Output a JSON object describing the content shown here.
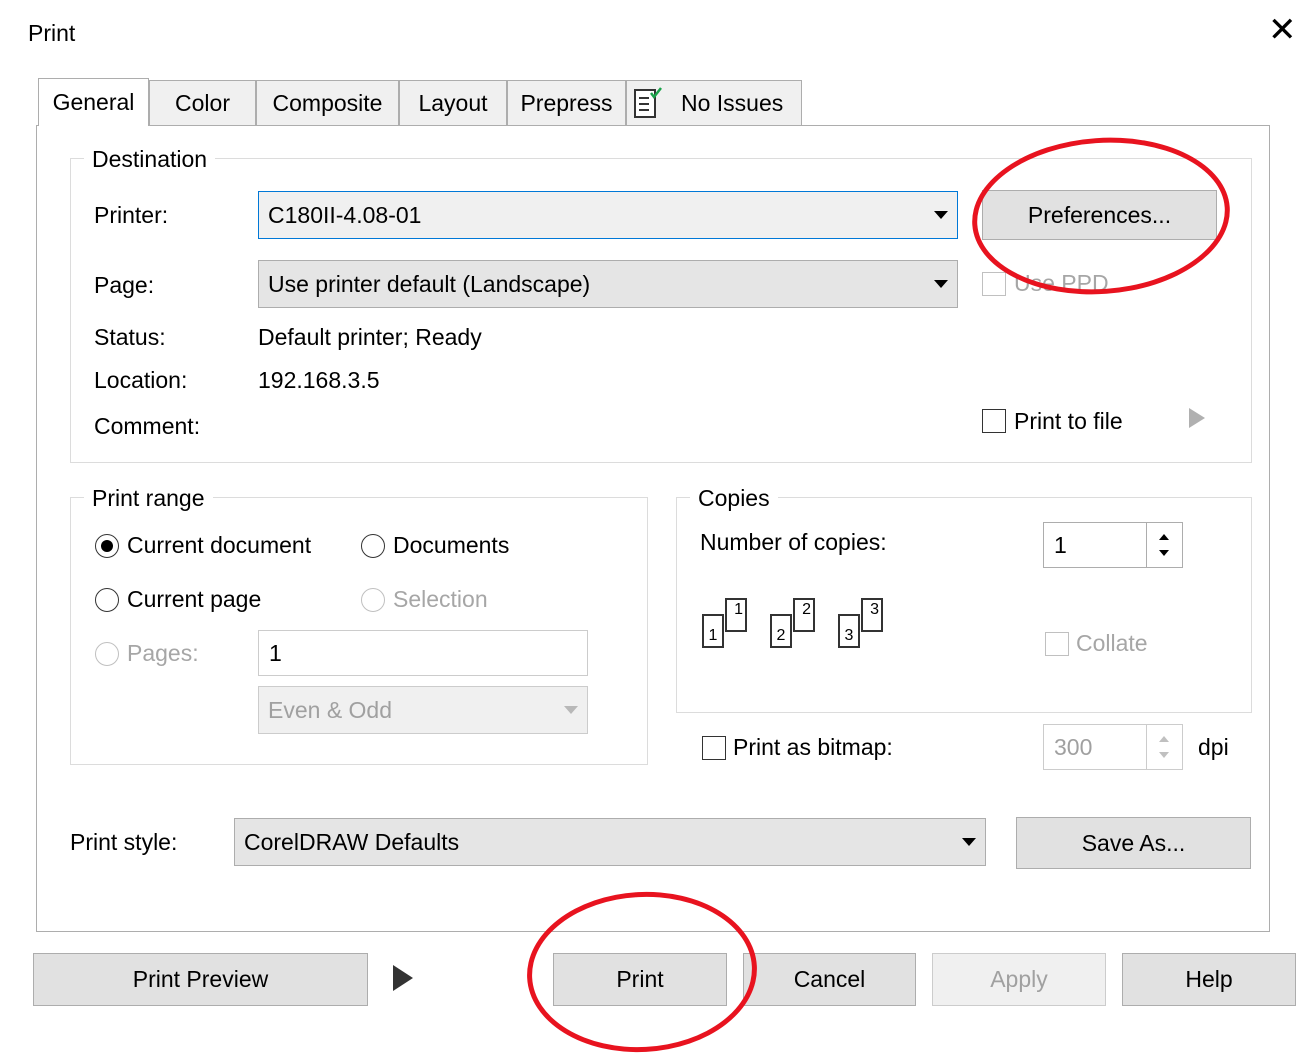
{
  "window": {
    "title": "Print",
    "close_icon": "close-icon"
  },
  "tabs": [
    {
      "label": "General",
      "active": true
    },
    {
      "label": "Color"
    },
    {
      "label": "Composite"
    },
    {
      "label": "Layout"
    },
    {
      "label": "Prepress"
    },
    {
      "label": "No Issues",
      "icon": "checklist-icon"
    }
  ],
  "destination": {
    "legend": "Destination",
    "printer_label": "Printer:",
    "printer_value": "C180II-4.08-01",
    "preferences_button": "Preferences...",
    "page_label": "Page:",
    "page_value": "Use printer default (Landscape)",
    "use_ppd_label": "Use PPD",
    "status_label": "Status:",
    "status_value": "Default printer; Ready",
    "location_label": "Location:",
    "location_value": "192.168.3.5",
    "comment_label": "Comment:",
    "print_to_file_label": "Print to file"
  },
  "print_range": {
    "legend": "Print range",
    "current_document": "Current document",
    "documents": "Documents",
    "current_page": "Current page",
    "selection": "Selection",
    "pages": "Pages:",
    "pages_value": "1",
    "even_odd": "Even & Odd"
  },
  "copies": {
    "legend": "Copies",
    "number_label": "Number of copies:",
    "number_value": "1",
    "collate_label": "Collate",
    "page_numbers": [
      "1",
      "1",
      "2",
      "2",
      "3",
      "3"
    ]
  },
  "bitmap": {
    "label": "Print as bitmap:",
    "dpi_value": "300",
    "dpi_unit": "dpi"
  },
  "print_style": {
    "label": "Print style:",
    "value": "CorelDRAW Defaults",
    "save_as_button": "Save As..."
  },
  "footer": {
    "print_preview": "Print Preview",
    "print": "Print",
    "cancel": "Cancel",
    "apply": "Apply",
    "help": "Help"
  },
  "colors": {
    "annotation": "#e8131f",
    "focus_border": "#0078d7"
  }
}
